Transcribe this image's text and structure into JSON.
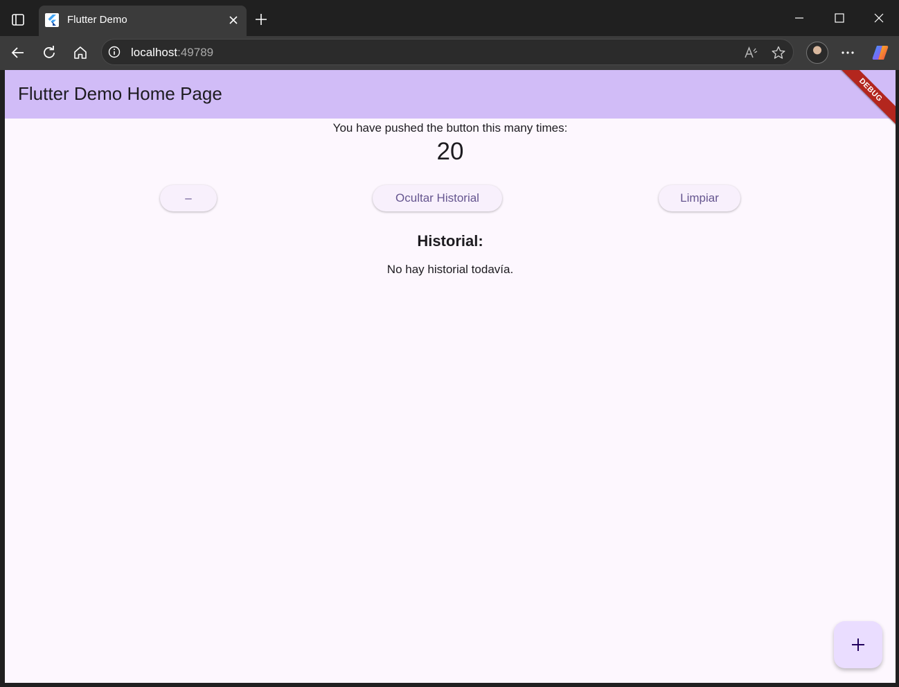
{
  "browser": {
    "tab": {
      "title": "Flutter Demo"
    },
    "address": {
      "host": "localhost",
      "port": ":49789"
    }
  },
  "app": {
    "appbar_title": "Flutter Demo Home Page",
    "debug_banner": "DEBUG",
    "pushed_text": "You have pushed the button this many times:",
    "counter": "20",
    "buttons": {
      "decrement": "–",
      "toggle_history": "Ocultar Historial",
      "clear": "Limpiar"
    },
    "history_title": "Historial:",
    "history_empty": "No hay historial todavía.",
    "fab_icon": "plus-icon"
  },
  "colors": {
    "appbar": "#d1bcf7",
    "background": "#fdf7fe",
    "button_text": "#65558f",
    "fab": "#eaddff",
    "debug_banner": "#b3261e"
  }
}
